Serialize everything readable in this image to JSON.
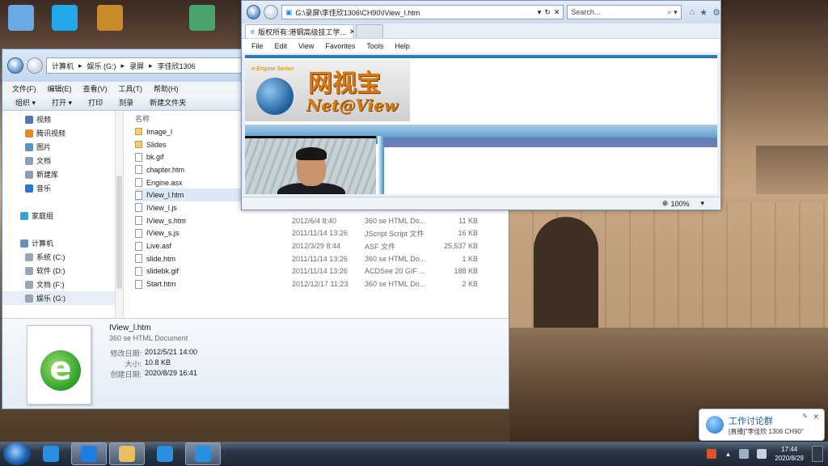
{
  "desktop": {
    "icons": [
      {
        "name": "computer-icon",
        "color": "#6aa9e6"
      },
      {
        "name": "video-player-icon",
        "color": "#21a8e8"
      },
      {
        "name": "archive-icon",
        "color": "#c98a2a"
      },
      {
        "name": "app-launcher-icon",
        "color": "#4aa36a"
      }
    ]
  },
  "explorer": {
    "address_parts": [
      "计算机",
      "娱乐 (G:)",
      "录屏",
      "李佳欣1306"
    ],
    "menu": [
      "文件(F)",
      "编辑(E)",
      "查看(V)",
      "工具(T)",
      "帮助(H)"
    ],
    "toolbar": [
      "组织 ▾",
      "打开 ▾",
      "打印",
      "刻录",
      "新建文件夹"
    ],
    "nav_items": [
      {
        "label": "视频",
        "color": "#4b78b8",
        "indent": 28
      },
      {
        "label": "腾讯视频",
        "color": "#e08a2a",
        "indent": 28
      },
      {
        "label": "图片",
        "color": "#5a8fc7",
        "indent": 28
      },
      {
        "label": "文档",
        "color": "#8c9fb8",
        "indent": 28
      },
      {
        "label": "新建库",
        "color": "#8c9fb8",
        "indent": 28
      },
      {
        "label": "音乐",
        "color": "#2a78c9",
        "indent": 28
      },
      {
        "label": "",
        "color": "transparent",
        "indent": 28
      },
      {
        "label": "家庭组",
        "color": "#3aa0d8",
        "indent": 22
      },
      {
        "label": "",
        "color": "transparent",
        "indent": 28
      },
      {
        "label": "计算机",
        "color": "#6a8fb8",
        "indent": 22
      },
      {
        "label": "系统 (C:)",
        "color": "#9aa6b5",
        "indent": 28
      },
      {
        "label": "软件 (D:)",
        "color": "#9aa6b5",
        "indent": 28
      },
      {
        "label": "文档 (F:)",
        "color": "#9aa6b5",
        "indent": 28
      },
      {
        "label": "娱乐 (G:)",
        "color": "#9aa6b5",
        "indent": 28
      }
    ],
    "column_name": "名称",
    "files": [
      {
        "name": "Image_l",
        "folder": true,
        "date": "",
        "type": "",
        "size": ""
      },
      {
        "name": "Slides",
        "folder": true,
        "date": "",
        "type": "",
        "size": ""
      },
      {
        "name": "bk.gif",
        "folder": false,
        "date": "",
        "type": "",
        "size": ""
      },
      {
        "name": "chapter.htm",
        "folder": false,
        "date": "",
        "type": "",
        "size": ""
      },
      {
        "name": "Engine.asx",
        "folder": false,
        "date": "",
        "type": "",
        "size": ""
      },
      {
        "name": "IView_l.htm",
        "folder": false,
        "date": "",
        "type": "",
        "size": "",
        "selected": true
      },
      {
        "name": "IView_l.js",
        "folder": false,
        "date": "",
        "type": "",
        "size": ""
      },
      {
        "name": "IView_s.htm",
        "folder": false,
        "date": "2012/6/4 8:40",
        "type": "360 se HTML Do...",
        "size": "11 KB"
      },
      {
        "name": "IView_s.js",
        "folder": false,
        "date": "2011/11/14 13:26",
        "type": "JScript Script 文件",
        "size": "16 KB"
      },
      {
        "name": "Live.asf",
        "folder": false,
        "date": "2012/3/29 8:44",
        "type": "ASF 文件",
        "size": "25,537 KB"
      },
      {
        "name": "slide.htm",
        "folder": false,
        "date": "2011/11/14 13:26",
        "type": "360 se HTML Do...",
        "size": "1 KB"
      },
      {
        "name": "slidebk.gif",
        "folder": false,
        "date": "2011/11/14 13:26",
        "type": "ACDSee 20 GIF ...",
        "size": "188 KB"
      },
      {
        "name": "Start.htm",
        "folder": false,
        "date": "2012/12/17 11:23",
        "type": "360 se HTML Do...",
        "size": "2 KB"
      }
    ],
    "details": {
      "filename": "IView_l.htm",
      "filetype": "360 se HTML Document",
      "rows": [
        {
          "k": "修改日期:",
          "v": "2012/5/21 14:00"
        },
        {
          "k": "大小:",
          "v": "10.8 KB"
        },
        {
          "k": "创建日期:",
          "v": "2020/8/29 16:41"
        }
      ]
    }
  },
  "ie": {
    "address": "G:\\录屏\\李佳欣1306\\CH90\\IView_l.htm",
    "search_placeholder": "Search...",
    "tab_title": "版权所有:港钢高级技工学...",
    "menu": [
      "File",
      "Edit",
      "View",
      "Favorites",
      "Tools",
      "Help"
    ],
    "logo_series": "e-Engine Series",
    "logo_cn": "网视宝",
    "logo_en": "Net@View",
    "zoom": "100%"
  },
  "notification": {
    "title": "工作讨论群",
    "message": "[直播]\"李佳欣 1306 CH90\""
  },
  "taskbar": {
    "apps": [
      {
        "name": "ie-taskbar-icon",
        "color": "#2a8fe0"
      },
      {
        "name": "chat-app-icon",
        "color": "#1f7fe0",
        "active": true
      },
      {
        "name": "file-explorer-icon",
        "color": "#e8c060",
        "active": true
      },
      {
        "name": "media-app-icon",
        "color": "#2a8fe0"
      },
      {
        "name": "ie-window-icon",
        "color": "#2a8fe0",
        "active": true
      }
    ],
    "time": "17:44",
    "date": "2020/8/29"
  }
}
